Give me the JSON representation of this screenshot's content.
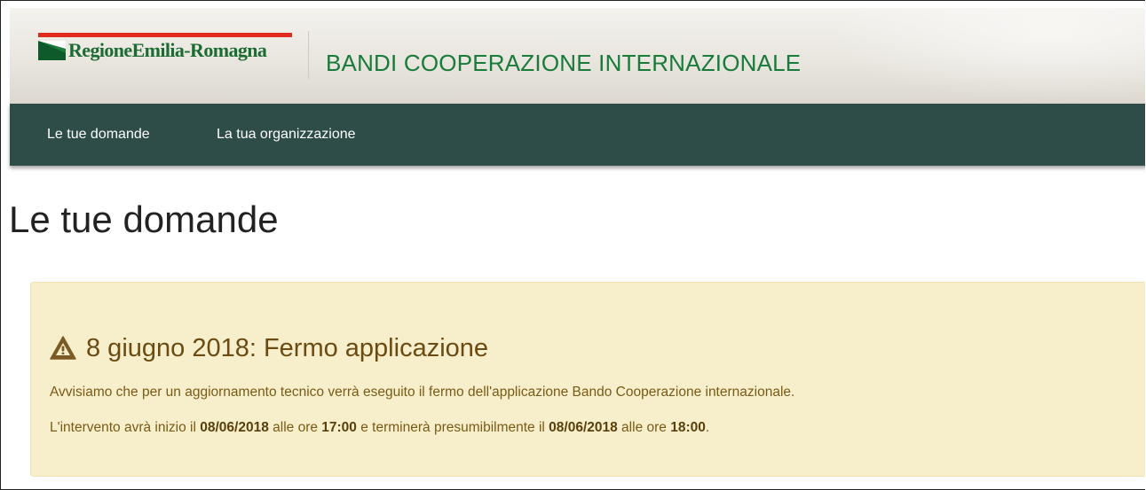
{
  "header": {
    "logo_text": "RegioneEmilia-Romagna",
    "app_title": "BANDI COOPERAZIONE INTERNAZIONALE"
  },
  "nav": {
    "items": [
      {
        "label": "Le tue domande"
      },
      {
        "label": "La tua organizzazione"
      }
    ]
  },
  "page": {
    "title": "Le tue domande"
  },
  "alert": {
    "icon": "warning-icon",
    "title": "8 giugno 2018: Fermo applicazione",
    "line1": "Avvisiamo che per un aggiornamento tecnico verrà eseguito il fermo dell'applicazione Bando Cooperazione internazionale.",
    "line2": {
      "t1": "L'intervento avrà inizio il ",
      "start_date": "08/06/2018",
      "t2": " alle ore ",
      "start_time": "17:00",
      "t3": " e terminerà presumibilmente il ",
      "end_date": "08/06/2018",
      "t4": " alle ore ",
      "end_time": "18:00",
      "t5": "."
    }
  },
  "colors": {
    "brand_green": "#1a7a3a",
    "nav_bg": "#2e4c48",
    "alert_bg": "#f7efcb",
    "alert_text": "#7a5a14",
    "logo_red": "#e02a20"
  }
}
